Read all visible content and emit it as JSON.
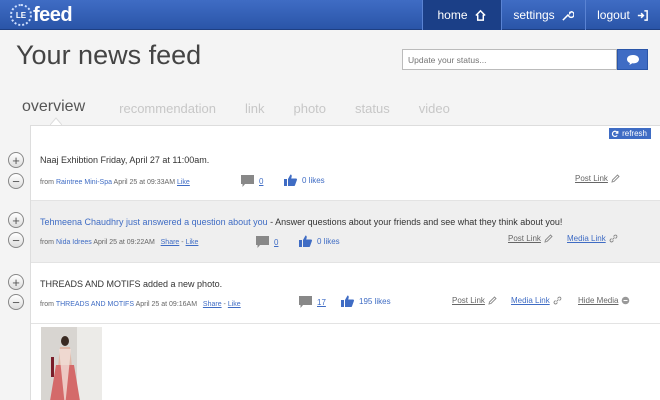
{
  "app": {
    "logo_badge": "LE",
    "logo_text": "feed",
    "nav": [
      {
        "label": "home",
        "icon": "home-icon",
        "active": true
      },
      {
        "label": "settings",
        "icon": "wrench-icon",
        "active": false
      },
      {
        "label": "logout",
        "icon": "logout-icon",
        "active": false
      }
    ]
  },
  "header": {
    "title": "Your news feed",
    "status_placeholder": "Update your status..."
  },
  "tabs": [
    "overview",
    "recommendation",
    "link",
    "photo",
    "status",
    "video"
  ],
  "feed": {
    "refresh_label": "refresh",
    "entries": [
      {
        "text": "Naaj Exhibtion Friday, April 27 at 11:00am.",
        "from_label": "from",
        "source": "Raintree Mini-Spa",
        "time": "April 25 at 09:33AM",
        "like": "Like",
        "comments": "0",
        "likes": "0 likes",
        "actions": [
          "Post Link"
        ]
      },
      {
        "text_link": "Tehmeena Chaudhry just answered a question about you",
        "text_rest": " - Answer questions about your friends and see what they think about you!",
        "from_label": "from",
        "source": "Nida Idrees",
        "time": "April 25 at 09:22AM",
        "share": "Share",
        "like": "Like",
        "comments": "0",
        "likes": "0 likes",
        "actions": [
          "Post Link",
          "Media Link"
        ]
      },
      {
        "text": "THREADS AND MOTIFS added a new photo.",
        "from_label": "from",
        "source": "THREADS AND MOTIFS",
        "time": "April 25 at 09:16AM",
        "share": "Share",
        "like": "Like",
        "comments": "17",
        "likes": "195 likes",
        "actions": [
          "Post Link",
          "Media Link",
          "Hide Media"
        ]
      }
    ],
    "sep": "-"
  },
  "colors": {
    "brand": "#3f6cc4",
    "nav_active": "#1b3f87"
  }
}
